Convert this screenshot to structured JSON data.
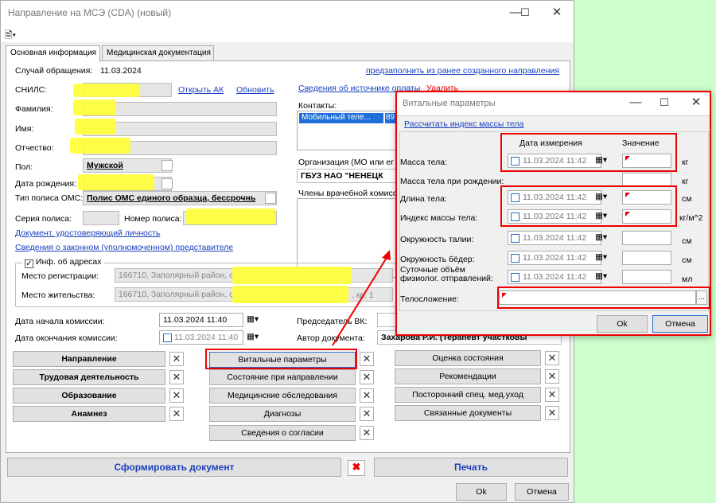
{
  "window": {
    "title": "Направление на МСЭ (CDA) (новый)",
    "min": "—",
    "max": "☐",
    "close": "✕"
  },
  "toolbar": {
    "icon": "🖹▾"
  },
  "tabs": [
    {
      "label": "Основная информация"
    },
    {
      "label": "Медицинская документация"
    }
  ],
  "main": {
    "case_label": "Случай обращения:",
    "case_date": "11.03.2024",
    "prefill_link": "предзаполнить из ранее созданного направления",
    "snils_label": "СНИЛС:",
    "open_ak": "Открыть АК",
    "refresh": "Обновить",
    "payment_link": "Сведения об источнике оплаты",
    "delete": "Удалить",
    "surname_label": "Фамилия:",
    "name_label": "Имя:",
    "patronymic_label": "Отчество:",
    "contacts_label": "Контакты:",
    "contact_item": "Мобильный теле...",
    "contact_num": "89",
    "sex_label": "Пол:",
    "sex_value": "Мужской",
    "birth_label": "Дата рождения:",
    "org_label": "Организация (МО или ег",
    "org_value": "ГБУЗ НАО \"НЕНЕЦК",
    "policy_type_label": "Тип полиса ОМС:",
    "policy_type_value": "Полис ОМС единого образца, бессрочнь",
    "members_label": "Члены врачебной комисс",
    "policy_series_label": "Серия полиса:",
    "policy_number_label": "Номер полиса:",
    "id_doc_link": "Документ, удостоверяющий личность",
    "rep_link": "Сведения о законном (уполномоченном) представителе",
    "addr_check": "Инф. об адресах",
    "reg_label": "Место регистрации:",
    "reg_value": "166710, Заполярный район, с",
    "live_label": "Место жительства:",
    "live_value": "166710, Заполярный район, с",
    "live_suffix": ", кв. 1",
    "start_label": "Дата начала комиссии:",
    "start_value": "11.03.2024 11:40",
    "end_label": "Дата окончания комиссии:",
    "end_value": "11.03.2024 11:40",
    "chair_label": "Председатель ВК:",
    "author_label": "Автор документа:",
    "author_value": "Захарова Р.И. (Терапевт участковы"
  },
  "buttons": {
    "col1": [
      "Направление",
      "Трудовая деятельность",
      "Образование",
      "Анамнез"
    ],
    "col2": [
      "Витальные параметры",
      "Состояние при направлении",
      "Медицинские обследования",
      "Диагнозы",
      "Сведения о согласии"
    ],
    "col3": [
      "Оценка состояния",
      "Рекомендации",
      "Посторонний спец. мед.уход",
      "Связанные документы"
    ],
    "x": "✕"
  },
  "footer": {
    "generate": "Сформировать документ",
    "print": "Печать",
    "ok": "Ok",
    "cancel": "Отмена"
  },
  "dialog": {
    "title": "Витальные параметры",
    "bmi_link": "Рассчитать индекс массы тела",
    "col_date": "Дата измерения",
    "col_value": "Значение",
    "rows": [
      {
        "label": "Масса тела:",
        "date": "11.03.2024 11:42",
        "unit": "кг"
      },
      {
        "label": "Масса тела при рождении:",
        "date": "",
        "unit": "кг"
      },
      {
        "label": "Длина тела:",
        "date": "11.03.2024 11:42",
        "unit": "см"
      },
      {
        "label": "Индекс массы тела:",
        "date": "11.03.2024 11:42",
        "unit": "кг/м^2"
      },
      {
        "label": "Окружность талии:",
        "date": "11.03.2024 11:42",
        "unit": "см"
      },
      {
        "label": "Окружность бёдер:",
        "date": "11.03.2024 11:42",
        "unit": "см"
      },
      {
        "label": "Суточные объём физиолог. отправлений:",
        "date": "11.03.2024 11:42",
        "unit": "мл"
      }
    ],
    "body_label": "Телосложение:",
    "ok": "Ok",
    "cancel": "Отмена"
  },
  "colors": {
    "accent_red": "#ee0000",
    "link": "#1a3fbf",
    "highlight": "#ffff33",
    "bg": "#ccffcc"
  }
}
